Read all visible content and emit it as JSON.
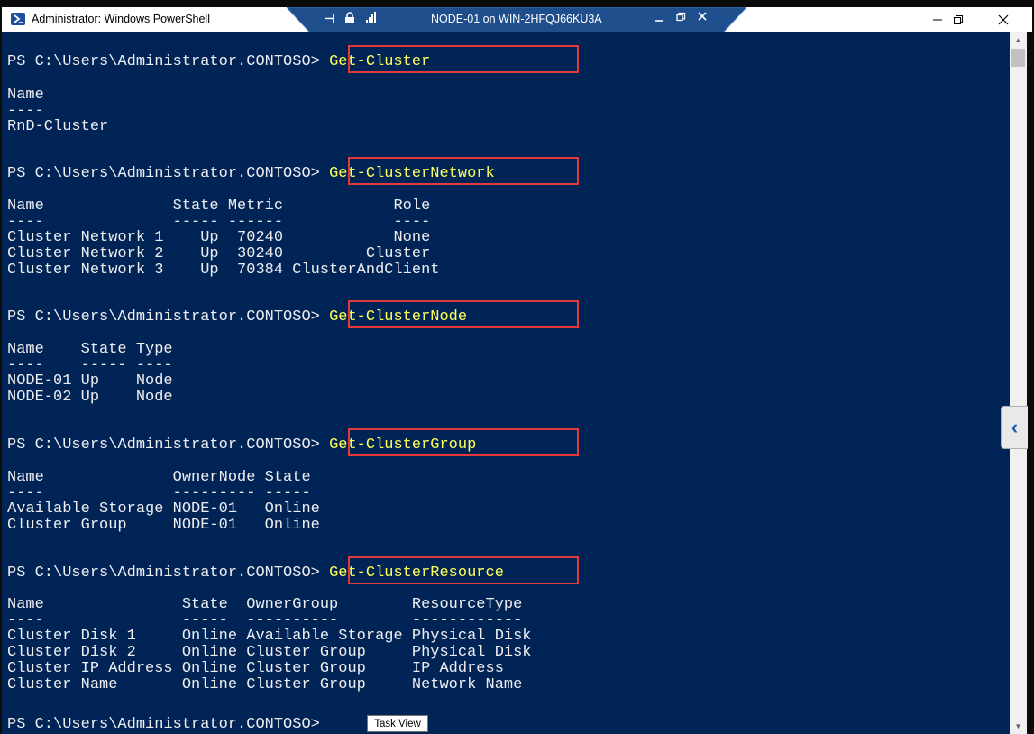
{
  "window": {
    "title": "Administrator: Windows PowerShell",
    "minimize_icon": "minimize-icon",
    "restore_icon": "restore-icon",
    "close_icon": "close-icon"
  },
  "rdp_bar": {
    "title": "NODE-01 on WIN-2HFQJ66KU3A",
    "icons": [
      "pin-icon",
      "lock-icon",
      "signal-icon",
      "minimize-icon",
      "restore-icon",
      "close-icon"
    ]
  },
  "prompt": "PS C:\\Users\\Administrator.CONTOSO>",
  "blocks": [
    {
      "command": "Get-Cluster",
      "output": [
        "Name",
        "----",
        "RnD-Cluster"
      ]
    },
    {
      "command": "Get-ClusterNetwork",
      "output": [
        "Name              State Metric            Role",
        "----              ----- ------            ----",
        "Cluster Network 1    Up  70240            None",
        "Cluster Network 2    Up  30240         Cluster",
        "Cluster Network 3    Up  70384 ClusterAndClient"
      ]
    },
    {
      "command": "Get-ClusterNode",
      "output": [
        "Name    State Type",
        "----    ----- ----",
        "NODE-01 Up    Node",
        "NODE-02 Up    Node"
      ]
    },
    {
      "command": "Get-ClusterGroup",
      "output": [
        "Name              OwnerNode State",
        "----              --------- -----",
        "Available Storage NODE-01   Online",
        "Cluster Group     NODE-01   Online"
      ]
    },
    {
      "command": "Get-ClusterResource",
      "output": [
        "Name               State  OwnerGroup        ResourceType",
        "----               -----  ----------        ------------",
        "Cluster Disk 1     Online Available Storage Physical Disk",
        "Cluster Disk 2     Online Cluster Group     Physical Disk",
        "Cluster IP Address Online Cluster Group     IP Address",
        "Cluster Name       Online Cluster Group     Network Name"
      ]
    }
  ],
  "tooltip": "Task View",
  "colors": {
    "console_bg": "#012456",
    "command_text": "#ffff57",
    "highlight_box": "#e5383b"
  }
}
